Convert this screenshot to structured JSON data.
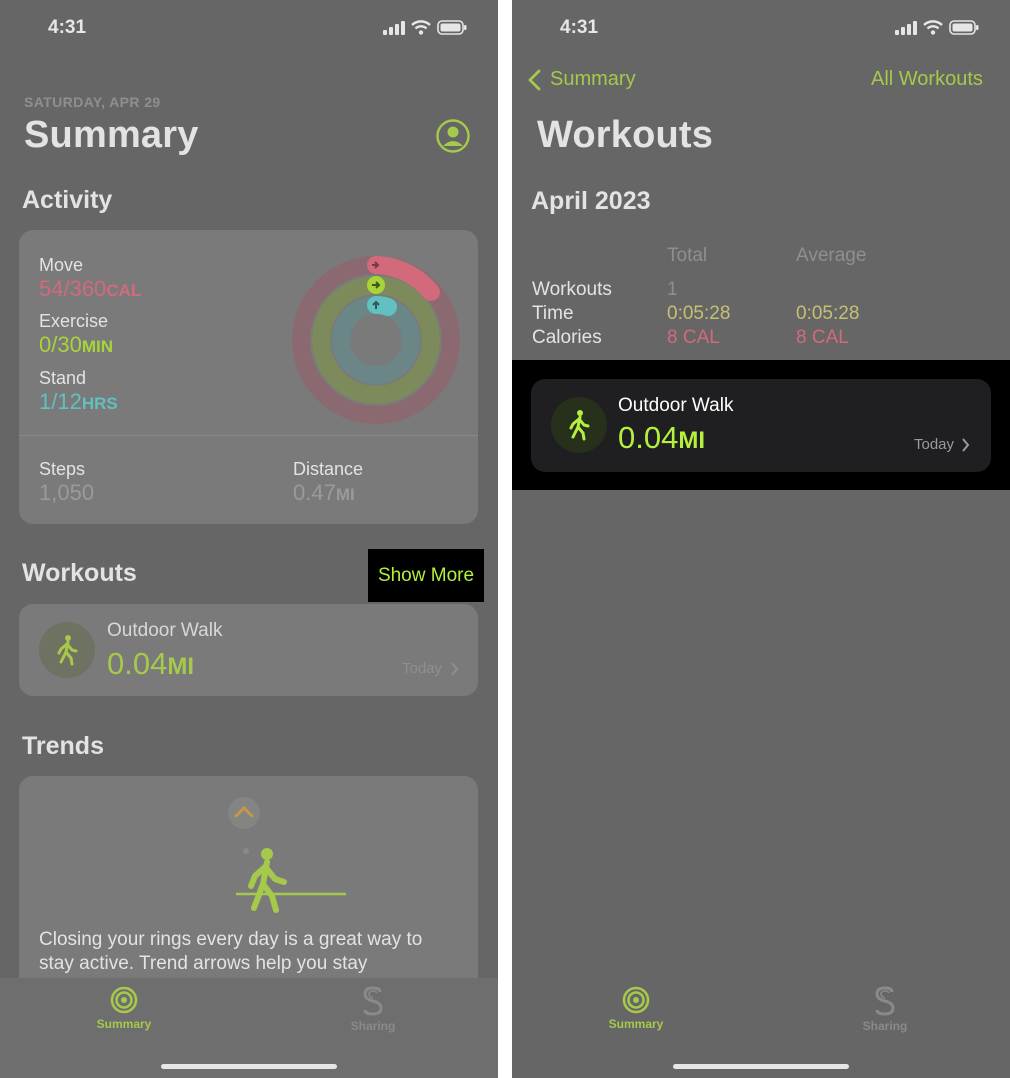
{
  "left": {
    "status": {
      "time": "4:31"
    },
    "date": "SATURDAY, APR 29",
    "title": "Summary",
    "activity": {
      "title": "Activity",
      "move": {
        "label": "Move",
        "value": "54/360",
        "unit": "CAL"
      },
      "exercise": {
        "label": "Exercise",
        "value": "0/30",
        "unit": "MIN"
      },
      "stand": {
        "label": "Stand",
        "value": "1/12",
        "unit": "HRS"
      },
      "steps": {
        "label": "Steps",
        "value": "1,050"
      },
      "distance": {
        "label": "Distance",
        "value": "0.47",
        "unit": "MI"
      }
    },
    "workouts": {
      "title": "Workouts",
      "show_more": "Show More",
      "item": {
        "name": "Outdoor Walk",
        "value": "0.04",
        "unit": "MI",
        "date": "Today"
      }
    },
    "trends": {
      "title": "Trends",
      "text": "Closing your rings every day is a great way to stay active. Trend arrows help you stay"
    },
    "tabs": [
      {
        "label": "Summary"
      },
      {
        "label": "Sharing"
      }
    ]
  },
  "right": {
    "status": {
      "time": "4:31"
    },
    "nav": {
      "back": "Summary",
      "all_workouts": "All Workouts"
    },
    "title": "Workouts",
    "month": "April 2023",
    "stats": {
      "col_total": "Total",
      "col_average": "Average",
      "rows": [
        {
          "label": "Workouts",
          "total": "1",
          "average": ""
        },
        {
          "label": "Time",
          "total": "0:05:28",
          "average": "0:05:28"
        },
        {
          "label": "Calories",
          "total": "8 CAL",
          "average": "8 CAL"
        }
      ]
    },
    "workout": {
      "name": "Outdoor Walk",
      "value": "0.04",
      "unit": "MI",
      "date": "Today"
    },
    "tabs": [
      {
        "label": "Summary"
      },
      {
        "label": "Sharing"
      }
    ]
  },
  "colors": {
    "accent_green": "#a5c94a",
    "bright_green": "#b4f03c",
    "move_red": "#d26a7c",
    "exercise_green": "#a8d43a",
    "stand_teal": "#62c0c0",
    "stat_yellow": "#c6c073"
  },
  "icons": [
    "signal-icon",
    "wifi-icon",
    "battery-icon",
    "profile-icon",
    "walking-icon",
    "chevron-right-icon",
    "chevron-left-icon",
    "chevron-up-icon",
    "activity-rings-icon",
    "sharing-icon"
  ]
}
